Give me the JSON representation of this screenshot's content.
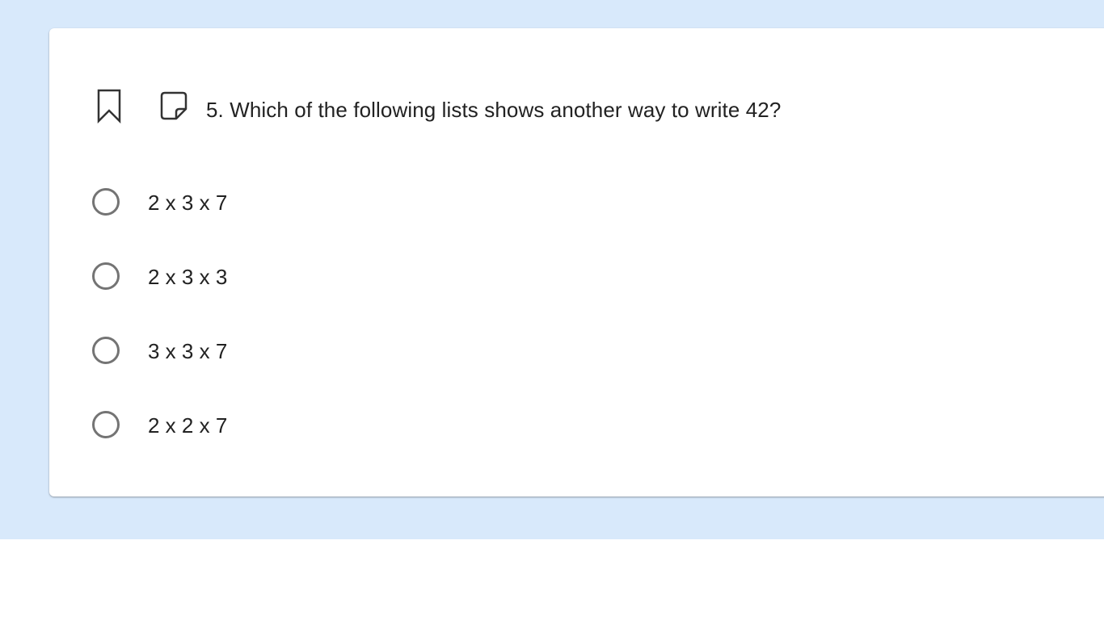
{
  "question": {
    "number_and_text": "5. Which of the following lists shows another way to write 42?",
    "bookmark_icon": "bookmark-icon",
    "note_icon": "sticky-note-icon"
  },
  "choices": [
    {
      "label": "2 x 3 x 7",
      "selected": false
    },
    {
      "label": "2 x 3 x 3",
      "selected": false
    },
    {
      "label": "3 x 3 x 7",
      "selected": false
    },
    {
      "label": "2 x 2 x 7",
      "selected": false
    }
  ],
  "colors": {
    "page_background": "#d8e9fb",
    "card_background": "#ffffff",
    "text": "#222222",
    "radio_border": "#747474"
  }
}
